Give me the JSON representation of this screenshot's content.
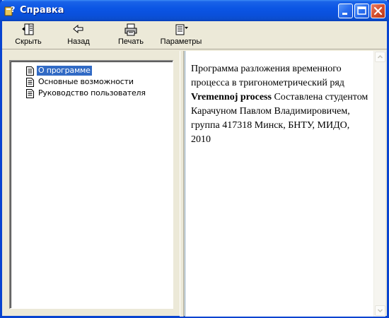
{
  "window": {
    "title": "Справка"
  },
  "toolbar": {
    "hide_label": "Скрыть",
    "back_label": "Назад",
    "print_label": "Печать",
    "options_label": "Параметры"
  },
  "tree": {
    "items": [
      {
        "label": "О программе",
        "selected": true
      },
      {
        "label": "Основные возможности",
        "selected": false
      },
      {
        "label": "Руководство пользователя",
        "selected": false
      }
    ]
  },
  "content": {
    "text_before": "Программа разложения временного процесса в тригонометрический ряд ",
    "bold_text": "Vremennoj process",
    "text_after": " Составлена студентом Карачуном Павлом Владимировичем, группа 417318 Минск, БНТУ, МИДО, 2010"
  },
  "colors": {
    "titlebar": "#0b55e4",
    "selection": "#316ac5",
    "frame": "#0843d0"
  }
}
